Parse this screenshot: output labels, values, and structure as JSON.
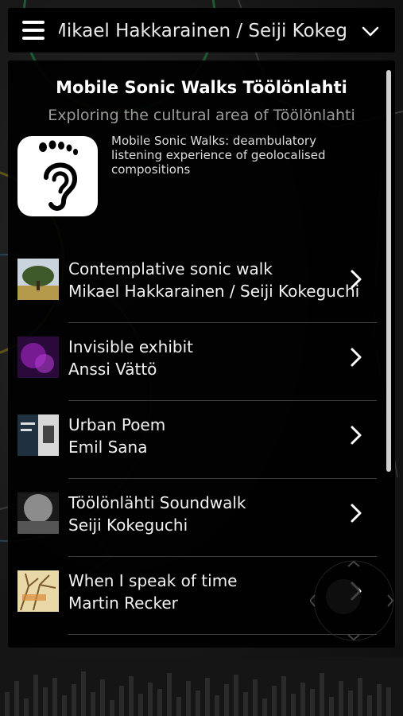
{
  "topbar": {
    "title": "Mikael Hakkarainen / Seiji Kokeguchi"
  },
  "header": {
    "title": "Mobile Sonic Walks Töölönlahti",
    "subtitle": "Exploring the cultural area of Töölönlahti",
    "description": "Mobile Sonic Walks: deambulatory listening experience of geolocalised compositions"
  },
  "walks": [
    {
      "title": "Contemplative sonic walk",
      "author": "Mikael Hakkarainen / Seiji Kokeguchi",
      "thumb": "tree"
    },
    {
      "title": "Invisible exhibit",
      "author": "Anssi Vättö",
      "thumb": "purple"
    },
    {
      "title": "Urban Poem",
      "author": "Emil Sana",
      "thumb": "poster"
    },
    {
      "title": "Töölönlähti Soundwalk",
      "author": "Seiji Kokeguchi",
      "thumb": "grey"
    },
    {
      "title": "When I speak of time",
      "author": "Martin Recker",
      "thumb": "branches"
    }
  ],
  "icons": {
    "menu": "hamburger-icon",
    "dropdown": "chevron-down-icon",
    "app": "foot-ear-icon",
    "item_arrow": "chevron-right-icon"
  }
}
